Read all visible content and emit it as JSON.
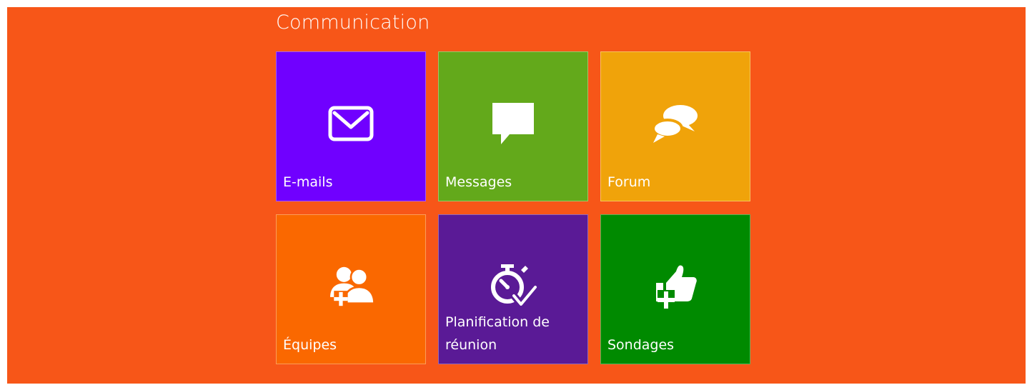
{
  "section": {
    "title": "Communication"
  },
  "colors": {
    "background": "#f75618",
    "emails": "#7000ff",
    "messages": "#63a91b",
    "forum": "#f0a30a",
    "equipes": "#fa6800",
    "planification": "#5a1a96",
    "sondages": "#008a00"
  },
  "tiles": [
    {
      "label": "E-mails",
      "icon": "envelope-icon"
    },
    {
      "label": "Messages",
      "icon": "speech-bubble-icon"
    },
    {
      "label": "Forum",
      "icon": "chat-bubbles-icon"
    },
    {
      "label": "Équipes",
      "icon": "group-add-icon"
    },
    {
      "label": "Planification de réunion",
      "icon": "stopwatch-check-icon"
    },
    {
      "label": "Sondages",
      "icon": "thumbs-up-add-icon"
    }
  ]
}
